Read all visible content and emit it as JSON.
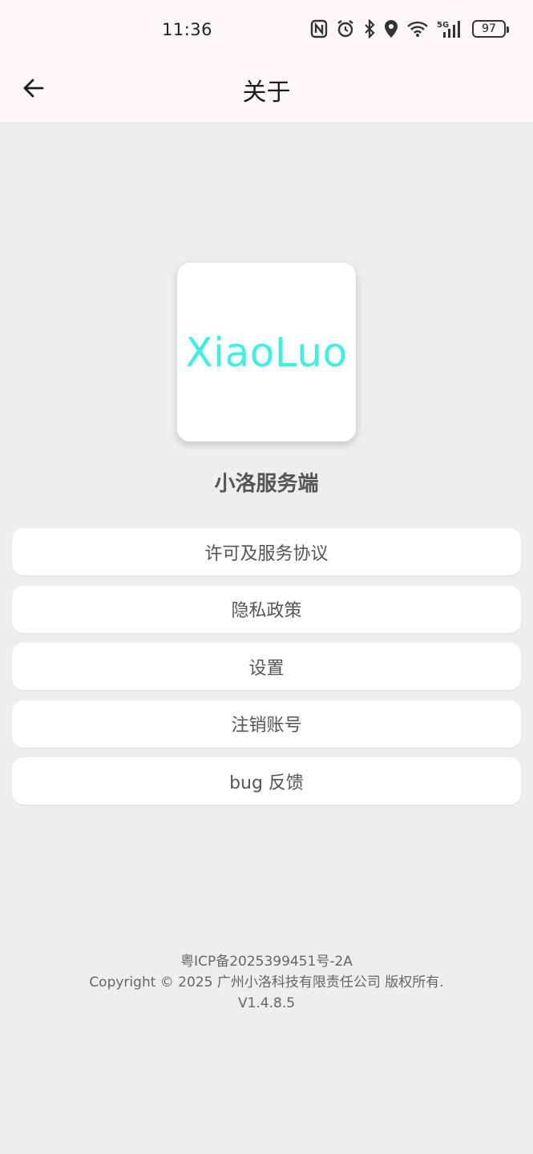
{
  "status_bar": {
    "time": "11:36",
    "battery": "97",
    "icons": [
      "nfc-icon",
      "alarm-icon",
      "bluetooth-icon",
      "location-icon",
      "wifi-icon",
      "signal-5g-icon",
      "battery-icon"
    ]
  },
  "app_bar": {
    "title": "关于",
    "back_icon": "arrow-left-icon"
  },
  "logo": {
    "text": "XiaoLuo",
    "color": "#3ff0e0"
  },
  "app_name": "小洛服务端",
  "menu": {
    "items": [
      {
        "label": "许可及服务协议"
      },
      {
        "label": "隐私政策"
      },
      {
        "label": "设置"
      },
      {
        "label": "注销账号"
      },
      {
        "label": "bug 反馈"
      }
    ]
  },
  "footer": {
    "icp": "粤ICP备2025399451号-2A",
    "copyright": "Copyright © 2025 广州小洛科技有限责任公司 版权所有.",
    "version": "V1.4.8.5"
  }
}
